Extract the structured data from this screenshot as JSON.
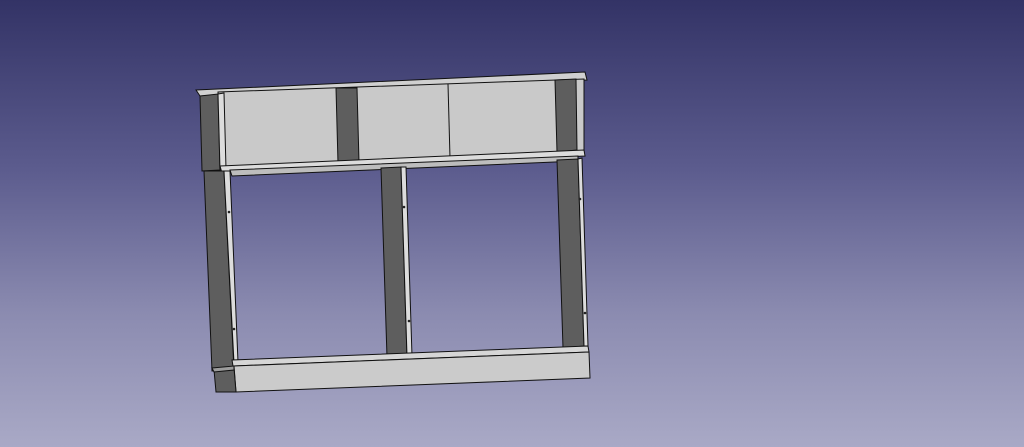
{
  "viewport": {
    "background_top": "#333366",
    "background_bottom": "#a9a9c6"
  },
  "model": {
    "description_icon": "3d-shelf-frame-model",
    "face_light": "#c8c8c8",
    "face_mid": "#a8a8a8",
    "face_dark": "#5e5e5e",
    "edge_color": "#111111"
  }
}
